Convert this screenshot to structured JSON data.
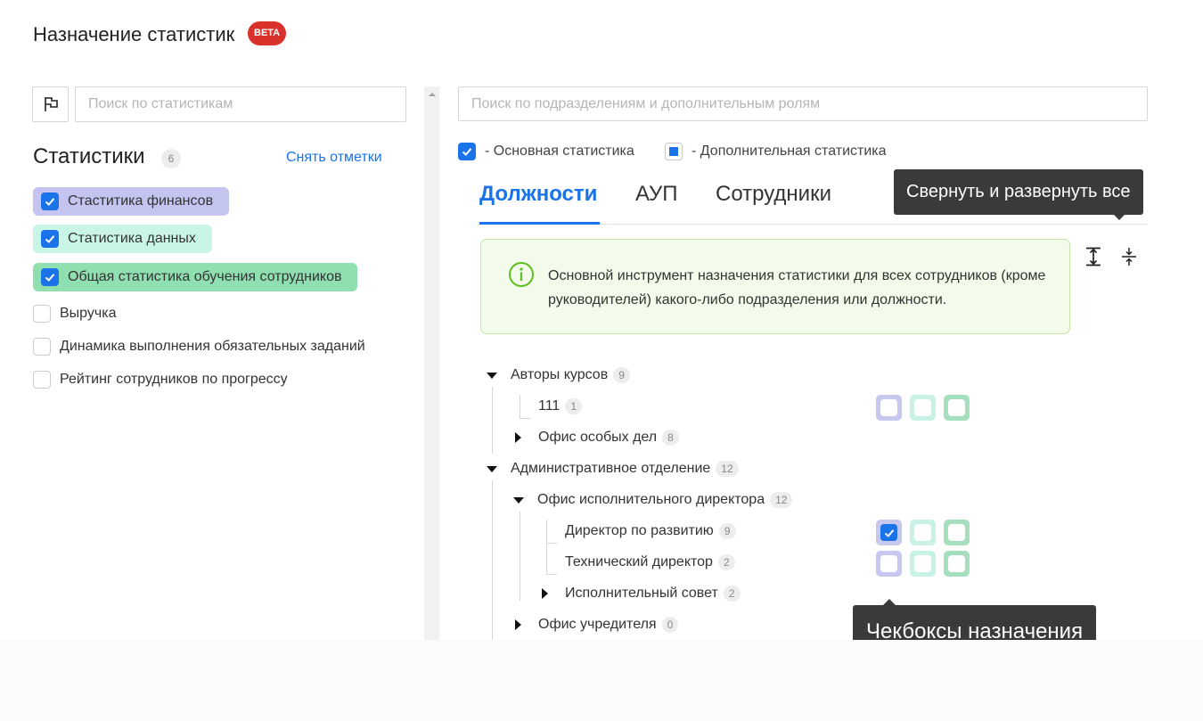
{
  "header": {
    "title": "Назначение статистик",
    "badge": "BETA"
  },
  "left": {
    "search_placeholder": "Поиск по статистикам",
    "heading": "Статистики",
    "count": "6",
    "unselect_label": "Снять отметки",
    "items": [
      {
        "label": "Стаститика финансов",
        "checked": true,
        "color": "#c3c4f0"
      },
      {
        "label": "Статистика данных",
        "checked": true,
        "color": "#c9f5e7"
      },
      {
        "label": "Общая статистика обучения сотрудников",
        "checked": true,
        "color": "#8fdfb0"
      },
      {
        "label": "Выручка",
        "checked": false
      },
      {
        "label": "Динамика выполнения обязательных заданий",
        "checked": false
      },
      {
        "label": "Рейтинг сотрудников по прогрессу",
        "checked": false
      }
    ]
  },
  "right": {
    "search_placeholder": "Поиск по подразделениям и дополнительным ролям",
    "legend": {
      "primary": "- Основная статистика",
      "secondary": "- Дополнительная статистика"
    },
    "tabs": [
      "Должности",
      "АУП",
      "Сотрудники"
    ],
    "active_tab": "Должности",
    "tooltip_collapse": "Свернуть и развернуть все",
    "info": "Основной инструмент назначения статистики для всех сотрудников (кроме руководителей) какого-либо подразделения или должности.",
    "tree": [
      {
        "label": "Авторы курсов",
        "count": "9",
        "arrow": "down",
        "depth": 0
      },
      {
        "label": "111",
        "count": "1",
        "arrow": "leaf",
        "depth": 1,
        "checks": [
          false,
          false,
          false
        ]
      },
      {
        "label": "Офис особых дел",
        "count": "8",
        "arrow": "right",
        "depth": 1
      },
      {
        "label": "Административное отделение",
        "count": "12",
        "arrow": "down",
        "depth": 0
      },
      {
        "label": "Офис исполнительного директора",
        "count": "12",
        "arrow": "down",
        "depth": 1
      },
      {
        "label": "Директор по развитию",
        "count": "9",
        "arrow": "leaf",
        "depth": 2,
        "checks": [
          true,
          false,
          false
        ]
      },
      {
        "label": "Технический директор",
        "count": "2",
        "arrow": "leaf",
        "depth": 2,
        "checks": [
          false,
          false,
          false
        ]
      },
      {
        "label": "Исполнительный совет",
        "count": "2",
        "arrow": "right",
        "depth": 2
      },
      {
        "label": "Офис учредителя",
        "count": "0",
        "arrow": "right",
        "depth": 1
      }
    ],
    "tooltip_checkboxes": "Чекбоксы назначения"
  },
  "colors": {
    "accent": "#1a73e8",
    "beta": "#d9322c"
  }
}
